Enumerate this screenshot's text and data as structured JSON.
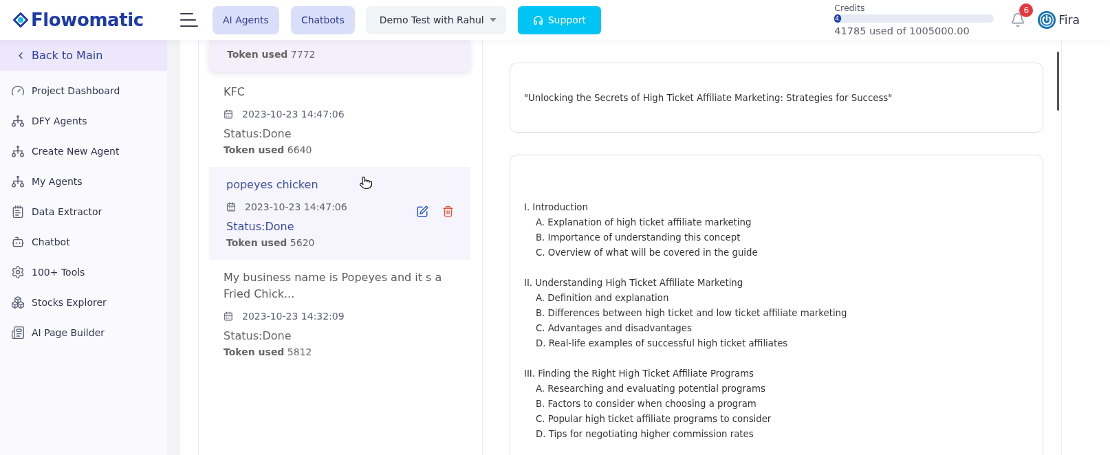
{
  "header": {
    "logo": "Flowomatic",
    "nav_buttons": [
      {
        "label": "AI Agents"
      },
      {
        "label": "Chatbots"
      }
    ],
    "project_select": {
      "value": "Demo Test with Rahul"
    },
    "support_button": {
      "label": "Support"
    },
    "credits": {
      "label": "Credits",
      "level": 0.04,
      "bar_text": "4.",
      "usage": "41785 used of 1005000.00"
    },
    "notifications": {
      "count": "6"
    },
    "user": {
      "name": "Fira"
    }
  },
  "sidebar": {
    "back_link": "Back to Main",
    "items": [
      {
        "label": "Project Dashboard"
      },
      {
        "label": "DFY Agents"
      },
      {
        "label": "Create New Agent"
      },
      {
        "label": "My Agents"
      },
      {
        "label": "Data Extractor"
      },
      {
        "label": "Chatbot"
      },
      {
        "label": "100+ Tools"
      },
      {
        "label": "Stocks Explorer"
      },
      {
        "label": "AI Page Builder"
      }
    ]
  },
  "history": {
    "items": [
      {
        "tokens": "**Token used** 7772",
        "selected": true,
        "hovered": false
      },
      {
        "title": "KFC",
        "date": "2023-10-23 14:47:06",
        "status": "Status:Done",
        "tokens": "**Token used** 6640",
        "selected": false,
        "hovered": false
      },
      {
        "title": "popeyes chicken",
        "date": "2023-10-23 14:47:06",
        "status": "Status:Done",
        "tokens": "**Token used** 5620",
        "selected": false,
        "hovered": true
      },
      {
        "title": "My business name is Popeyes and it s a Fried Chick...",
        "date": "2023-10-23 14:32:09",
        "status": "Status:Done",
        "tokens": "**Token used** 5812",
        "selected": false,
        "hovered": false
      }
    ]
  },
  "result": {
    "title": "\"Unlocking the Secrets of High Ticket Affiliate Marketing: Strategies for Success\"",
    "outline": [
      {
        "text": "I. Introduction",
        "children": [
          {
            "text": "A. Explanation of high ticket affiliate marketing"
          },
          {
            "text": "B. Importance of understanding this concept"
          },
          {
            "text": "C. Overview of what will be covered in the guide"
          }
        ]
      },
      {
        "text": "II. Understanding High Ticket Affiliate Marketing",
        "children": [
          {
            "text": "A. Definition and explanation"
          },
          {
            "text": "B. Differences between high ticket and low ticket affiliate marketing"
          },
          {
            "text": "C. Advantages and disadvantages"
          },
          {
            "text": "D. Real-life examples of successful high ticket affiliates"
          }
        ]
      },
      {
        "text": "III. Finding the Right High Ticket Affiliate Programs",
        "children": [
          {
            "text": "A. Researching and evaluating potential programs"
          },
          {
            "text": "B. Factors to consider when choosing a program"
          },
          {
            "text": "C. Popular high ticket affiliate programs to consider"
          },
          {
            "text": "D. Tips for negotiating higher commission rates"
          }
        ]
      }
    ]
  }
}
